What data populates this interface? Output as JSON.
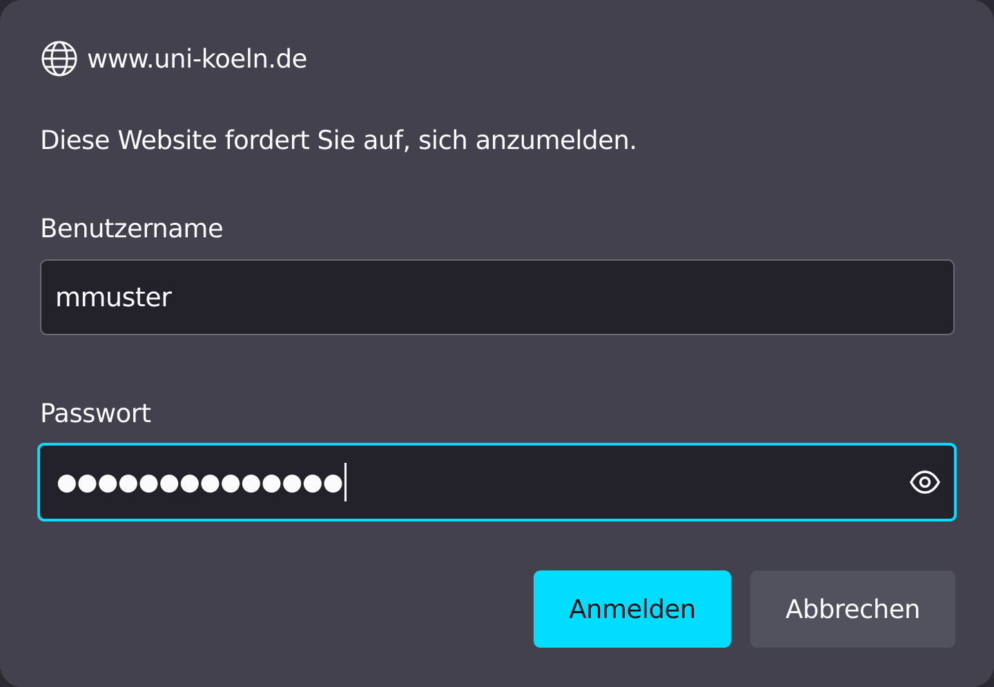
{
  "dialog": {
    "site": {
      "icon": "globe-icon",
      "host": "www.uni-koeln.de"
    },
    "prompt": "Diese Website fordert Sie auf, sich anzumelden.",
    "username": {
      "label": "Benutzername",
      "value": "mmuster"
    },
    "password": {
      "label": "Passwort",
      "masked_value": "●●●●●●●●●●●●●●",
      "reveal_icon": "eye-icon"
    },
    "buttons": {
      "login_label": "Anmelden",
      "cancel_label": "Abbrechen"
    },
    "colors": {
      "background": "#42414d",
      "accent": "#00ddff",
      "field_background": "#23222b",
      "secondary_button": "#52515e",
      "text": "#fbfbfe"
    }
  }
}
